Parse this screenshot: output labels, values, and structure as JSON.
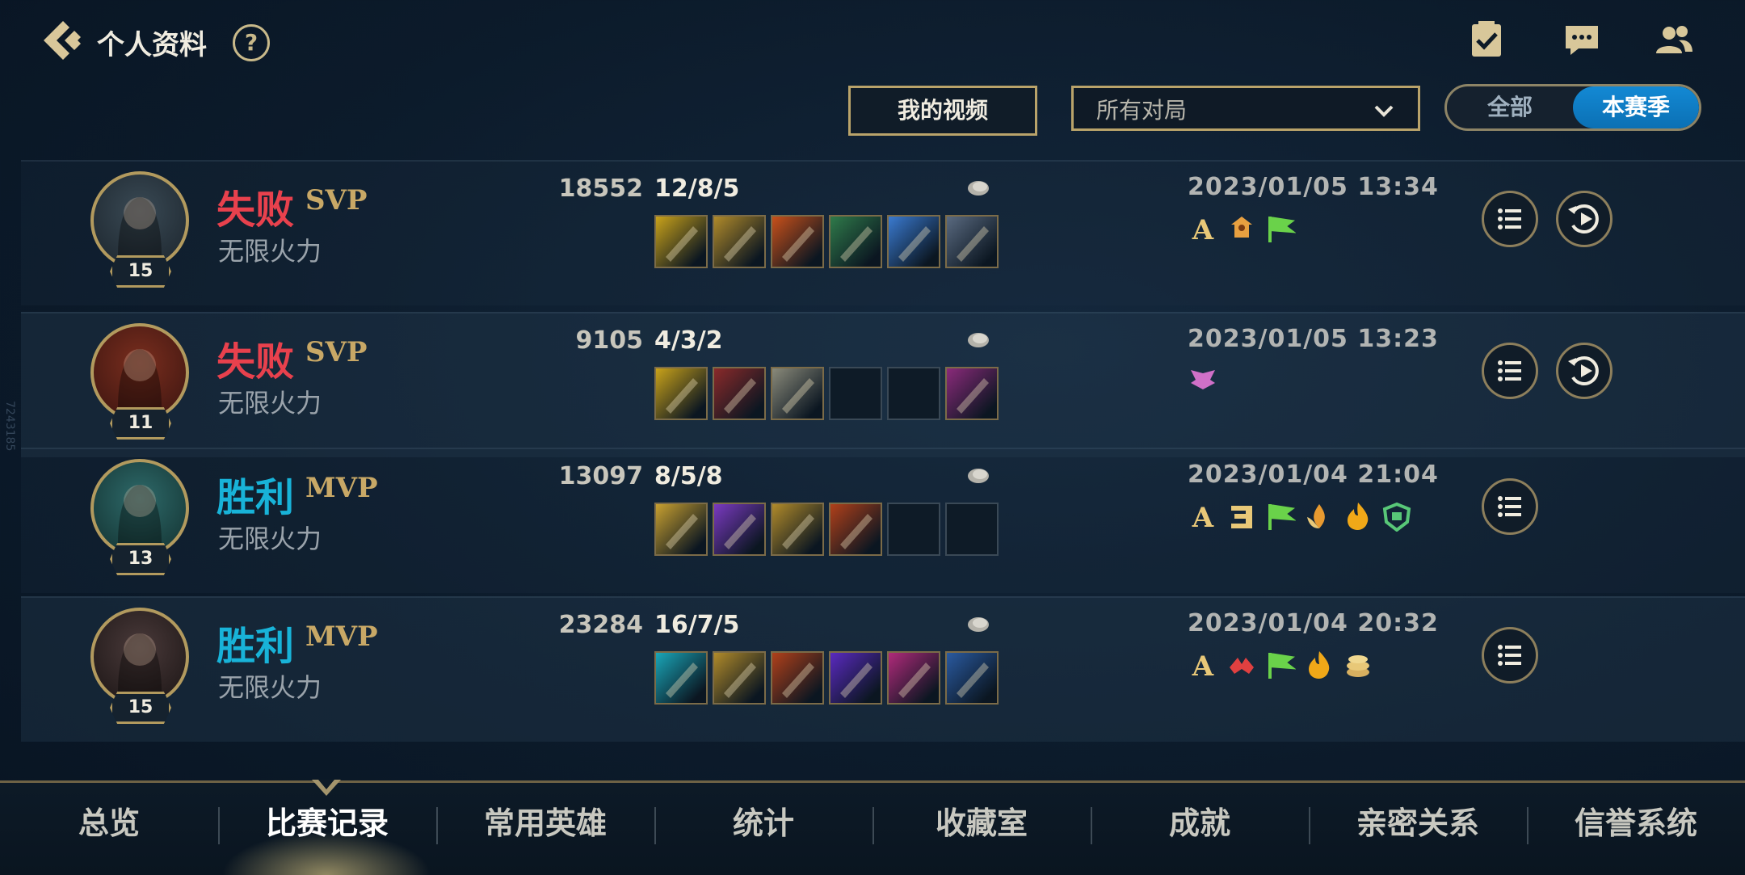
{
  "header": {
    "title": "个人资料",
    "help_label": "?"
  },
  "controls": {
    "my_video_label": "我的视频",
    "match_filter_value": "所有对局",
    "season_toggle": {
      "all_label": "全部",
      "season_label": "本赛季",
      "selected": "本赛季"
    }
  },
  "side_watermark": "7243185",
  "matches": [
    {
      "result": "失败",
      "tag": "SVP",
      "mode": "无限火力",
      "level": "15",
      "kda": "12/8/5",
      "gold": "18552",
      "datetime": "2023/01/05 13:34",
      "badges": [
        "A-grade-icon",
        "turret-icon",
        "first-blood-flag-icon"
      ],
      "items": [
        "yellow",
        "gold-blade",
        "fire-orb",
        "green-claw",
        "blue-crystal",
        "steel-boots"
      ],
      "has_replay": true
    },
    {
      "result": "失败",
      "tag": "SVP",
      "mode": "无限火力",
      "level": "11",
      "kda": "4/3/2",
      "gold": "9105",
      "datetime": "2023/01/05 13:23",
      "badges": [
        "wings-icon"
      ],
      "items": [
        "yellow",
        "red-axe",
        "cross-blades",
        "empty",
        "empty",
        "purple-boots"
      ],
      "has_replay": true
    },
    {
      "result": "胜利",
      "tag": "MVP",
      "mode": "无限火力",
      "level": "13",
      "kda": "8/5/8",
      "gold": "13097",
      "datetime": "2023/01/04 21:04",
      "badges": [
        "A-grade-icon",
        "triple-kill-icon",
        "first-blood-flag-icon",
        "lotus-fire-icon",
        "flame-icon",
        "shield-icon"
      ],
      "items": [
        "lightning-blade",
        "purple-scythe",
        "gold-blade",
        "red-spear",
        "empty",
        "empty"
      ],
      "has_replay": false
    },
    {
      "result": "胜利",
      "tag": "MVP",
      "mode": "无限火力",
      "level": "15",
      "kda": "16/7/5",
      "gold": "23284",
      "datetime": "2023/01/04 20:32",
      "badges": [
        "A-grade-icon",
        "double-kill-icon",
        "first-blood-flag-icon",
        "flame-icon",
        "coins-icon"
      ],
      "items": [
        "cyan-sword",
        "gold-blade",
        "red-spear",
        "purple-orb",
        "pink-blade",
        "golden-staff"
      ],
      "has_replay": false
    }
  ],
  "nav": {
    "items": [
      "总览",
      "比赛记录",
      "常用英雄",
      "统计",
      "收藏室",
      "成就",
      "亲密关系",
      "信誉系统"
    ],
    "active": "比赛记录"
  },
  "colors": {
    "loss": "#e8414d",
    "win": "#18b3d8",
    "gold_accent": "#b9a36a",
    "season_active": "#1389d4"
  }
}
